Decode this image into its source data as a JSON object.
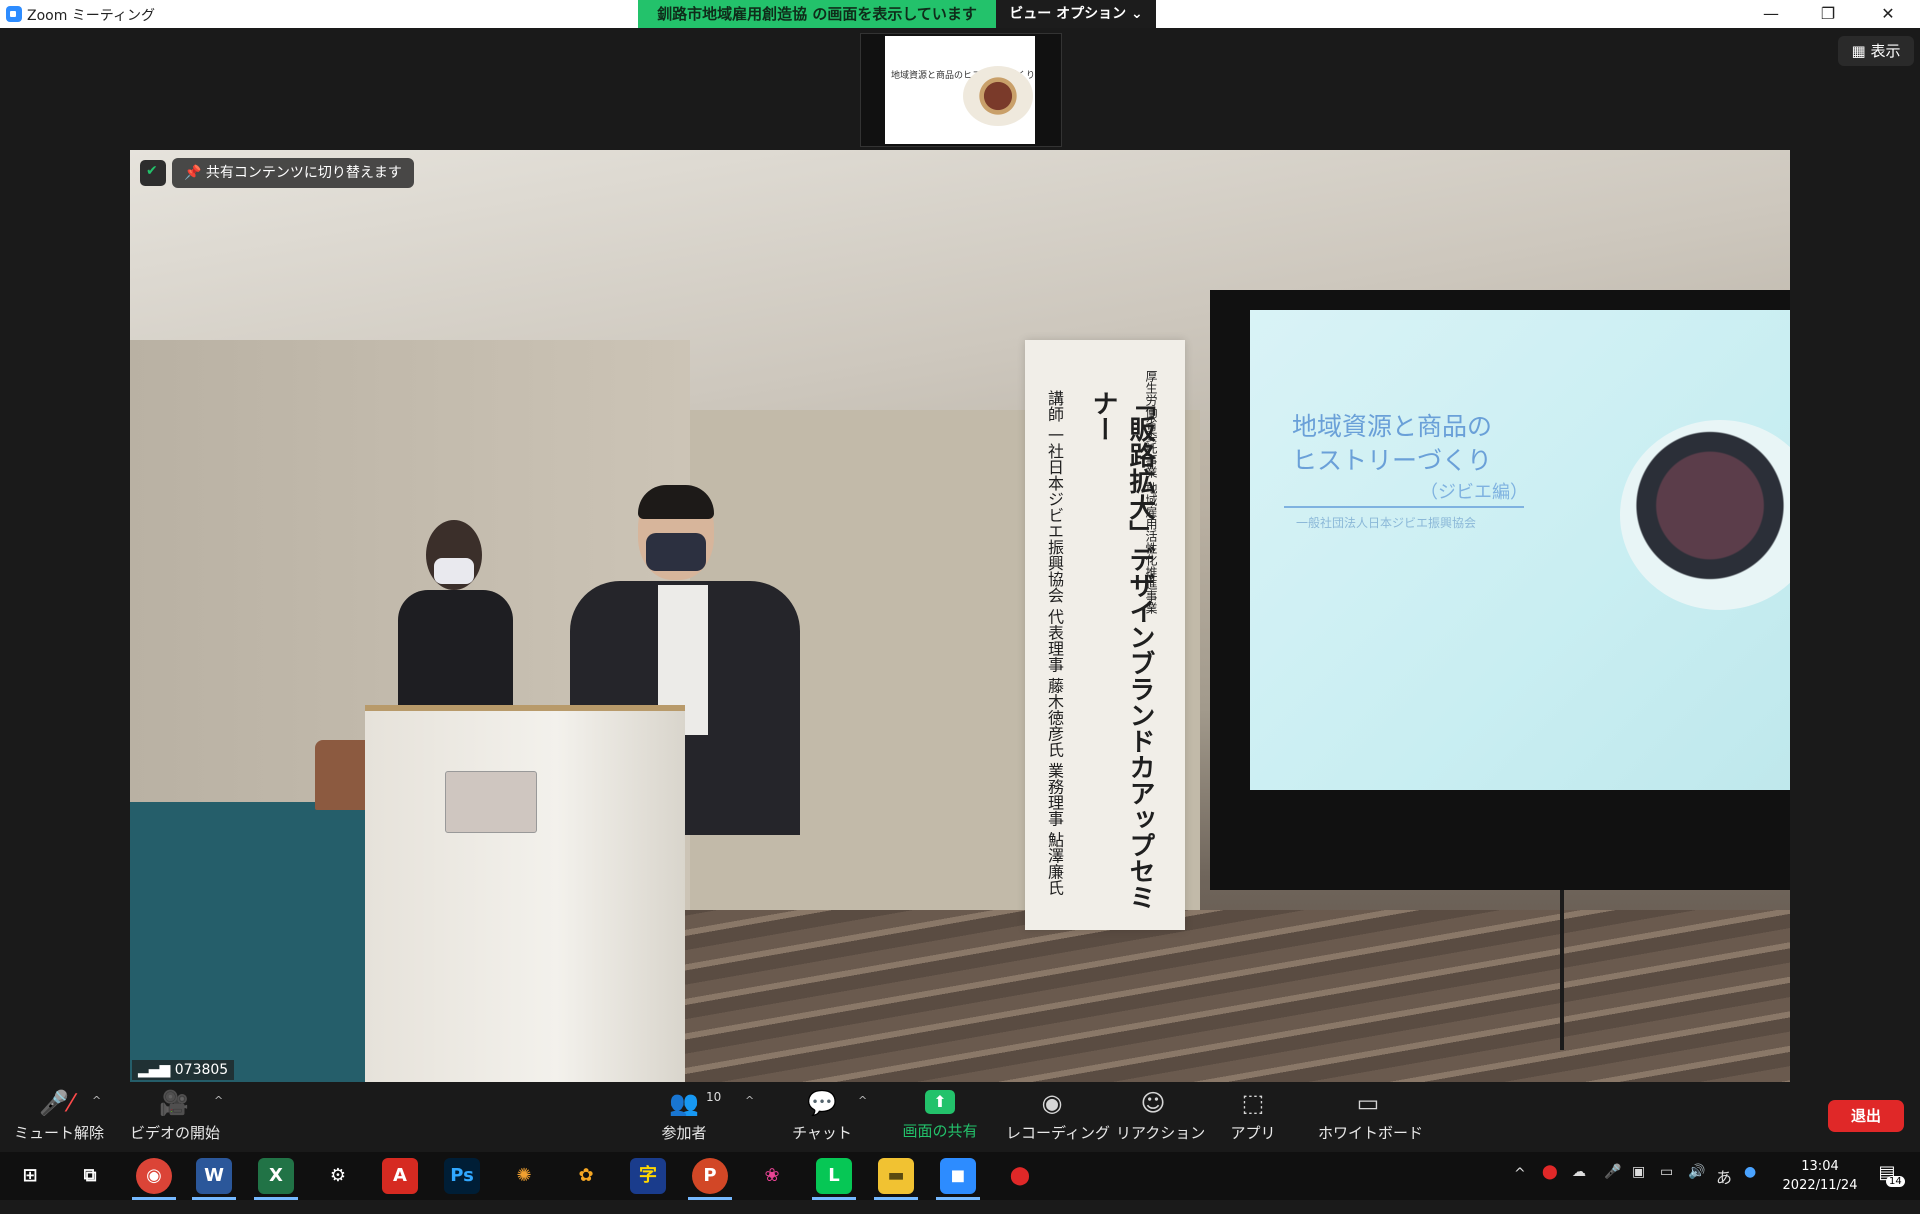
{
  "window": {
    "title": "Zoom ミーティング",
    "share_banner": "釧路市地域雇用創造協 の画面を表示しています",
    "view_options": "ビュー オプション ⌄",
    "min": "—",
    "restore": "❐",
    "close": "✕"
  },
  "meeting": {
    "view_button": "▦ 表示",
    "switch_hint": "共有コンテンツに切り替えます",
    "participant_id": "073805",
    "thumbnail": {
      "title": "地域資源と商品のヒストリーづくり"
    }
  },
  "slide": {
    "title_line1": "地域資源と商品の",
    "title_line2": "ヒストリーづくり",
    "subtitle": "（ジビエ編）",
    "org": "一般社団法人日本ジビエ振興協会"
  },
  "banner": {
    "col1": "厚生労働省委託事業 地域雇用活性化推進事業",
    "col2": "「販路拡大」デザインブランドカアップセミナー",
    "col3": "講師 一社日本ジビエ振興協会 代表理事 藤木徳彦氏 業務理事 鮎澤廉氏"
  },
  "toolbar": {
    "unmute": "ミュート解除",
    "start_video": "ビデオの開始",
    "participants": "参加者",
    "participant_count": "10",
    "chat": "チャット",
    "share_screen": "画面の共有",
    "recording": "レコーディング",
    "reactions": "リアクション",
    "apps": "アプリ",
    "whiteboard": "ホワイトボード",
    "leave": "退出"
  },
  "taskbar": {
    "time": "13:04",
    "date": "2022/11/24",
    "ime": "あ",
    "notification_count": "14",
    "apps": [
      "chrome-icon",
      "word-icon",
      "excel-icon",
      "settings-icon",
      "acrobat-icon",
      "photoshop-icon",
      "app-icon",
      "app-icon",
      "app-icon",
      "powerpoint-icon",
      "app-icon",
      "line-icon",
      "explorer-icon",
      "zoom-icon",
      "record-icon"
    ]
  },
  "colors": {
    "share_green": "#23c26b",
    "leave_red": "#e02828",
    "zoom_blue": "#2d8cff"
  }
}
